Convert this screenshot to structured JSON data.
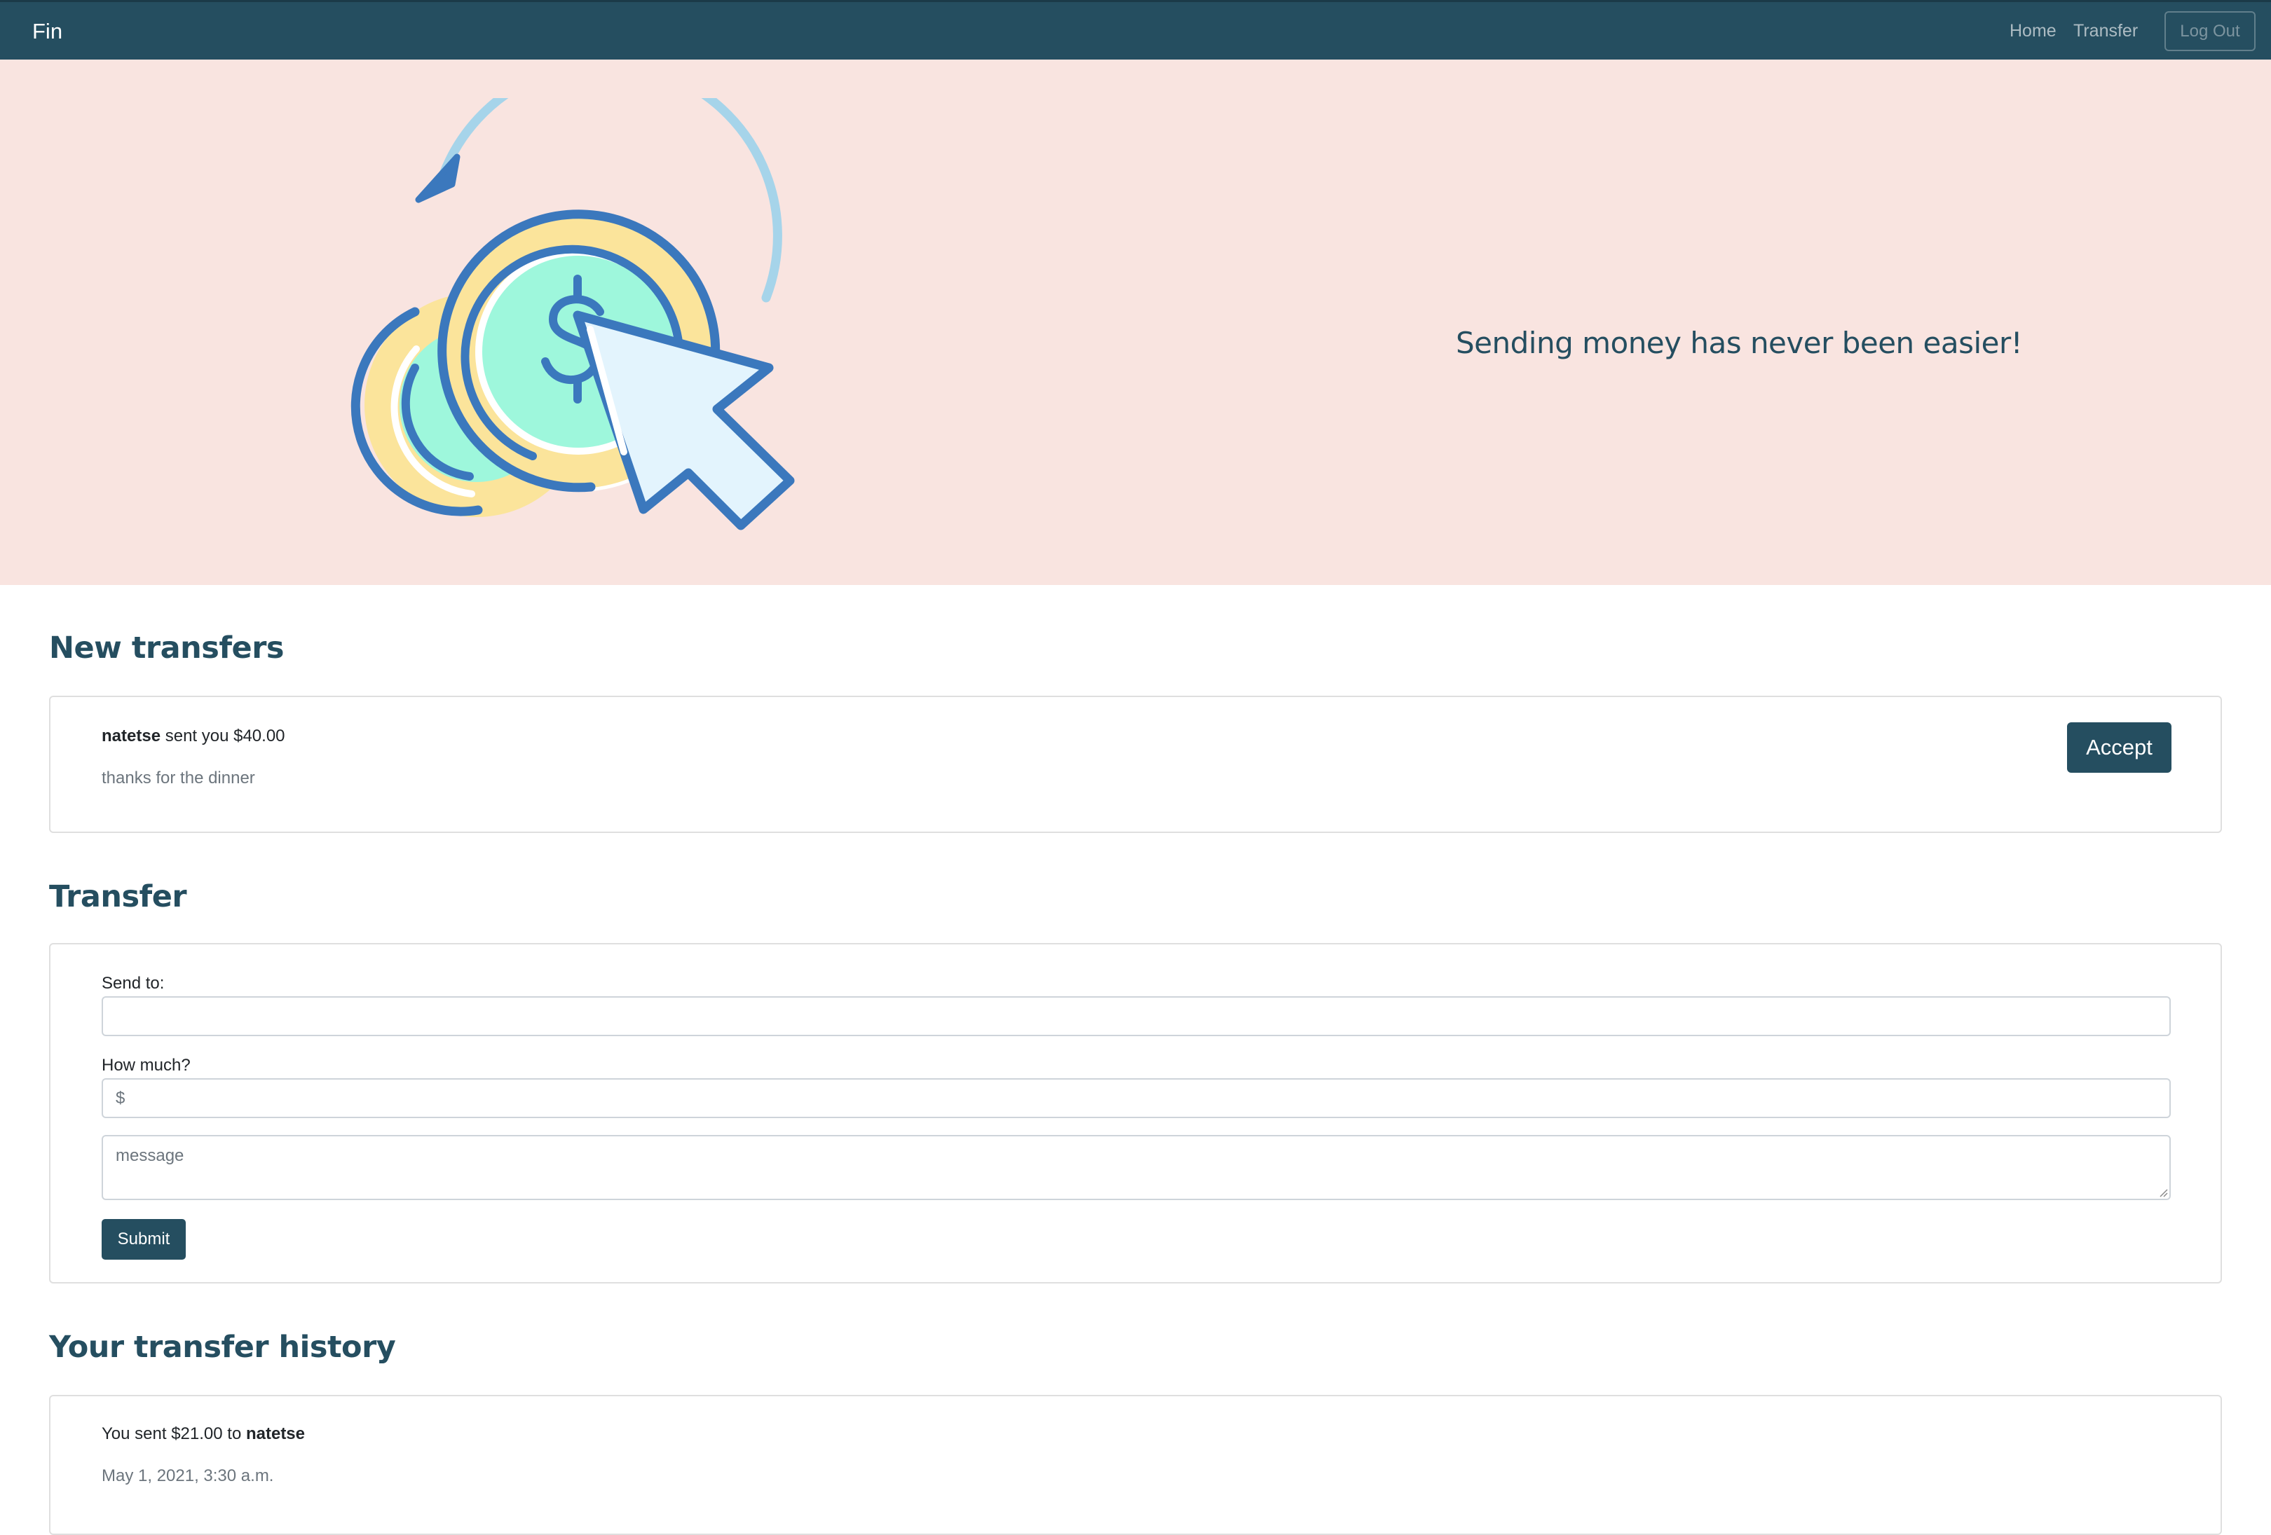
{
  "navbar": {
    "brand": "Fin",
    "links": {
      "home": "Home",
      "transfer": "Transfer"
    },
    "logout_label": "Log Out"
  },
  "hero": {
    "tagline": "Sending money has never been easier!",
    "illustration_icon": "coin-transfer-cursor-icon"
  },
  "new_transfers": {
    "title": "New transfers",
    "items": [
      {
        "sender": "natetse",
        "action_text": " sent you $40.00",
        "message": "thanks for the dinner",
        "accept_label": "Accept"
      }
    ]
  },
  "transfer_form": {
    "title": "Transfer",
    "send_to_label": "Send to:",
    "send_to_value": "",
    "amount_label": "How much?",
    "amount_placeholder": "$",
    "message_placeholder": "message",
    "submit_label": "Submit"
  },
  "history": {
    "title": "Your transfer history",
    "items": [
      {
        "prefix": "You sent $21.00 to ",
        "recipient": "natetse",
        "timestamp": "May 1, 2021, 3:30 a.m."
      }
    ]
  },
  "colors": {
    "primary": "#254e60",
    "hero_background": "#f9e4e0",
    "icon_blue": "#3b78bd",
    "icon_mint": "#9ef7dc",
    "icon_yellow": "#fbe49b",
    "icon_light_blue": "#a6d4ea"
  }
}
